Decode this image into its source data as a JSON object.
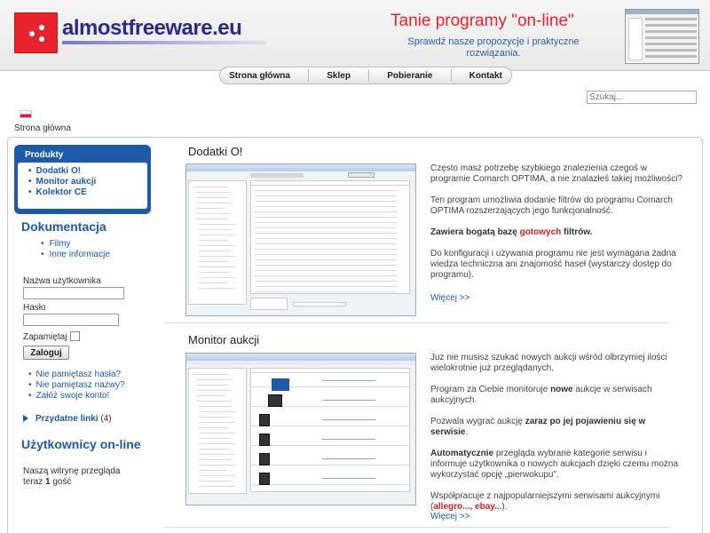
{
  "header": {
    "logo_text": "almostfreeware.eu",
    "promo_title": "Tanie programy \"on-line\"",
    "promo_subtitle": "Sprawdź nasze propozycje i praktyczne rozwiązania."
  },
  "nav": {
    "items": [
      "Strona główna",
      "Sklep",
      "Pobieranie",
      "Kontakt"
    ]
  },
  "search": {
    "placeholder": "Szukaj..."
  },
  "breadcrumb": "Strona główna",
  "sidebar": {
    "products_title": "Produkty",
    "products": [
      "Dodatki O!",
      "Monitor aukcji",
      "Kolektor CE"
    ],
    "documentation_title": "Dokumentacja",
    "documentation": [
      "Filmy",
      "Inne informacje"
    ],
    "login": {
      "username_label": "Nazwa użytkownika",
      "password_label": "Hasło",
      "remember_label": "Zapamiętaj",
      "submit_label": "Zaloguj",
      "links": [
        "Nie pamiętasz hasła?",
        "Nie pamiętasz nazwy?",
        "Załóż swoje konto!"
      ]
    },
    "useful_links": {
      "label": "Przydatne linki",
      "count": "(4)"
    },
    "online": {
      "title": "Użytkownicy on-line",
      "text_prefix": "Naszą witrynę przegląda teraz",
      "count": "1",
      "text_suffix": "gość"
    }
  },
  "articles": [
    {
      "title": "Dodatki O!",
      "paragraphs": [
        "Często masz potrzebę szybkiego znalezienia czegoś w programie Comarch OPTIMA, a nie znalazłeś takiej możliwości?",
        "Ten program umożliwia dodanie filtrów do programu Comarch OPTIMA rozszerzających jego funkcjonalność."
      ],
      "highlight": {
        "pre": "Zawiera bogatą bazę",
        "red": "gotowych",
        "post": "filtrów."
      },
      "last_paragraph": "Do konfiguracji i używania programu nie jest wymagana żadna wiedza techniczna ani znajomość haseł (wystarczy dostęp do programu).",
      "more": "Więcej >>"
    },
    {
      "title": "Monitor aukcji",
      "p1": "Już nie musisz szukać nowych aukcji wśród olbrzymiej ilości wielokrotnie już przeglądanych.",
      "p2": {
        "pre": "Program za Ciebie monitoruje",
        "bold": "nowe",
        "post": "aukcje w serwisach aukcyjnych."
      },
      "p3": {
        "pre": "Pozwala wygrać aukcję",
        "bold": "zaraz po jej pojawieniu się w serwisie",
        "post": "."
      },
      "p4": {
        "bold": "Automatycznie",
        "post": "przegląda wybrane kategorie serwisu i informuje użytkownika o nowych aukcjach dzięki czemu można wykorzystać opcję „pierwokupu\"."
      },
      "p5": {
        "pre": "Współpracuje z najpopularniejszymi serwisami aukcyjnymi (",
        "red": "allegro..., ebay...",
        "post": ")."
      },
      "more": "Więcej >>"
    }
  ],
  "colors": {
    "brand_red": "#e8232b",
    "brand_blue": "#1d5aa8",
    "logo_blue": "#2a2a8c"
  }
}
